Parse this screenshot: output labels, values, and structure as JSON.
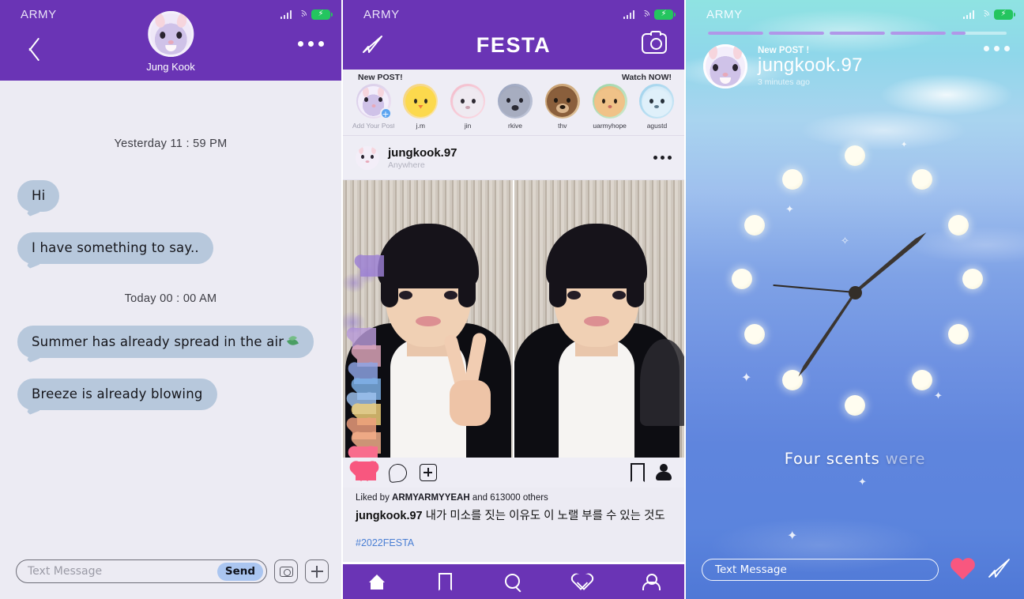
{
  "chat_panel": {
    "status": {
      "carrier": "ARMY",
      "icons": [
        "signal-icon",
        "wifi-icon",
        "battery-charging-icon"
      ]
    },
    "header": {
      "back": "back-chevron-icon",
      "avatar": "bunny-avatar",
      "name": "Jung Kook",
      "menu": "more-options-icon"
    },
    "timestamps": {
      "yesterday": "Yesterday 11 : 59 PM",
      "today": "Today 00 : 00 AM"
    },
    "messages": [
      {
        "text": "Hi"
      },
      {
        "text": "I have something to say.."
      },
      {
        "text": "Summer has already spread in the air",
        "emoji": "leaf-icon"
      },
      {
        "text": "Breeze is already blowing"
      }
    ],
    "composer": {
      "placeholder": "Text Message",
      "send_label": "Send",
      "camera": "camera-icon",
      "add": "plus-icon"
    }
  },
  "feed_panel": {
    "status": {
      "carrier": "ARMY"
    },
    "header": {
      "title": "FESTA",
      "send": "paper-plane-icon",
      "camera": "camera-icon"
    },
    "stories": {
      "left_label": "New POST!",
      "right_label": "Watch NOW!",
      "items": [
        {
          "name": "Add Your Post",
          "type": "add",
          "ring": "#cfc6de",
          "face": "bunny",
          "muted": true
        },
        {
          "name": "j.m",
          "type": "story",
          "ring": "#f2d27a",
          "face": "chick"
        },
        {
          "name": "jin",
          "type": "story",
          "ring": "#f3bccb",
          "face": "sheep"
        },
        {
          "name": "rkive",
          "type": "story",
          "ring": "#9aa3bd",
          "face": "koala"
        },
        {
          "name": "thv",
          "type": "story",
          "ring": "#c49a6a",
          "face": "bear"
        },
        {
          "name": "uarmyhope",
          "type": "story",
          "ring": "#9ad3a6",
          "face": "cat"
        },
        {
          "name": "agustd",
          "type": "story",
          "ring": "#9fd2ec",
          "face": "wolf"
        }
      ]
    },
    "post": {
      "username": "jungkook.97",
      "location": "Anywhere",
      "menu": "more-options-icon",
      "actions": {
        "like": "heart-icon",
        "comment": "comment-icon",
        "share": "plus-box-icon",
        "save": "bookmark-icon",
        "tag": "person-icon"
      },
      "likes_prefix": "Liked by",
      "likes_user": "ARMYARMYYEAH",
      "likes_suffix": "and 613000 others",
      "caption_user": "jungkook.97",
      "caption_text": "내가 미소를 짓는 이유도 이 노랠 부를 수 있는 것도",
      "hashtag": "#2022FESTA"
    },
    "tabbar": [
      {
        "name": "home-icon"
      },
      {
        "name": "bookmark-icon"
      },
      {
        "name": "search-icon"
      },
      {
        "name": "heart-icon"
      },
      {
        "name": "profile-icon"
      }
    ]
  },
  "story_panel": {
    "status": {
      "carrier": "ARMY"
    },
    "progress": {
      "segments": 5,
      "active_index": 4,
      "active_percent": 26
    },
    "header": {
      "new_label": "New POST !",
      "username": "jungkook.97",
      "time": "3 minutes ago",
      "menu": "more-options-icon",
      "avatar": "bunny-avatar"
    },
    "content": {
      "scene": "clock-over-sky",
      "caption_bright": "Four scents",
      "caption_faint": "were",
      "moon_count": 12
    },
    "composer": {
      "placeholder": "Text Message",
      "like": "heart-icon",
      "send": "paper-plane-icon"
    }
  },
  "colors": {
    "purple": "#6a34b5",
    "chat_bg": "#ecebf3",
    "bubble": "#b7c8dc",
    "send_btn": "#aac5f0",
    "link": "#4a7fd4",
    "story_progress": "#b097e8",
    "pink_heart": "#f8577f"
  }
}
